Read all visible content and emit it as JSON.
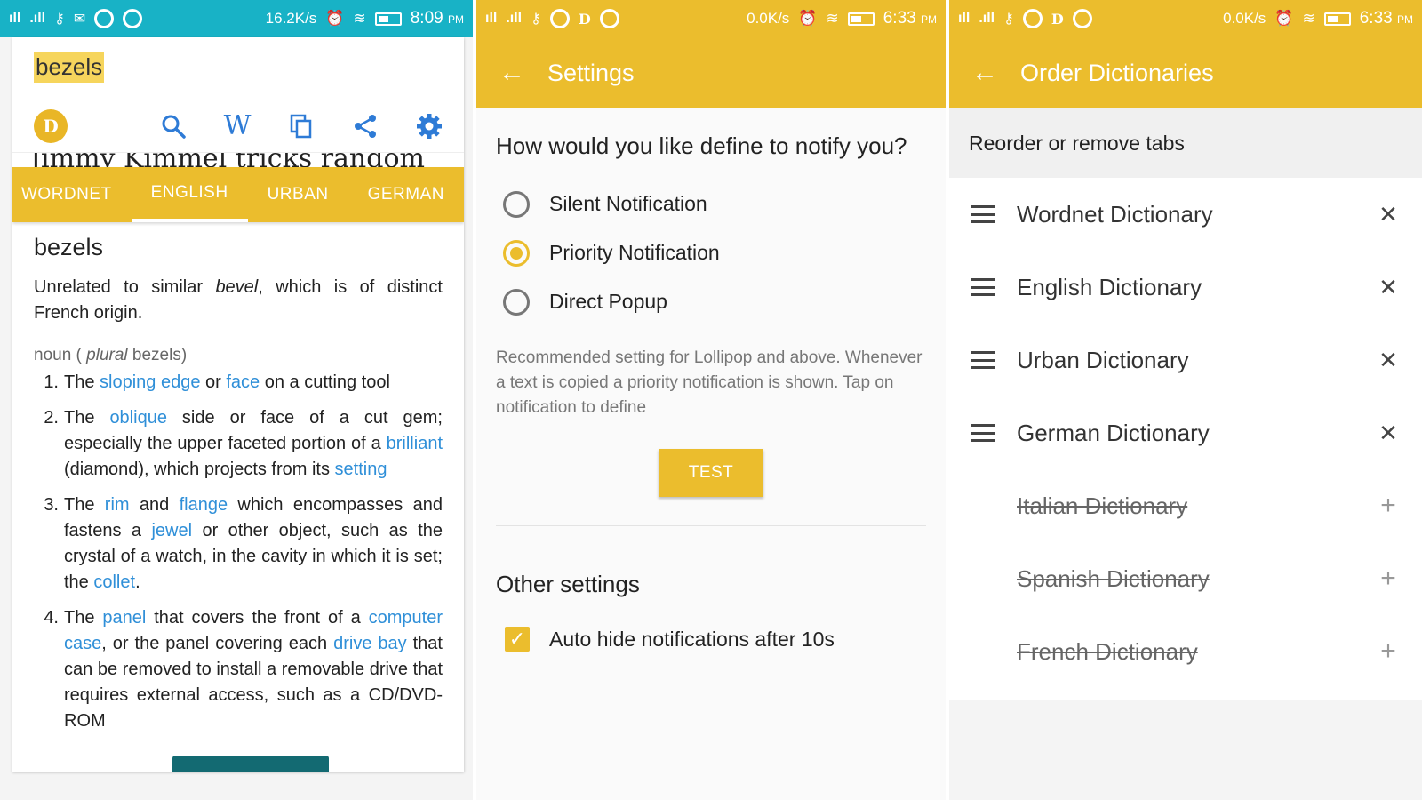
{
  "colors": {
    "teal_status": "#18b2c6",
    "accent": "#ebbd2d",
    "link": "#2f8fd8"
  },
  "panel1": {
    "status": {
      "speed": "16.2K/s",
      "time": "8:09",
      "ampm": "PM"
    },
    "search_word": "bezels",
    "toolbar": {
      "avatar_letter": "D",
      "icons": [
        "search-icon",
        "wikipedia-icon",
        "copy-icon",
        "share-icon",
        "settings-icon"
      ],
      "wiki_glyph": "W"
    },
    "peek_text": "Jimmy Kimmel tricks random",
    "tabs": [
      "WORDNET",
      "ENGLISH",
      "URBAN",
      "GERMAN"
    ],
    "active_tab": "ENGLISH",
    "definition": {
      "title": "bezels",
      "intro_a": "Unrelated to similar ",
      "intro_em": "bevel",
      "intro_b": ", which is of distinct French origin.",
      "pos_a": "noun ( ",
      "pos_em": "plural",
      "pos_b": " bezels)",
      "items": [
        {
          "num": "1.",
          "parts": [
            [
              "The ",
              false
            ],
            [
              "sloping edge",
              true
            ],
            [
              " or ",
              false
            ],
            [
              "face",
              true
            ],
            [
              " on a cutting tool",
              false
            ]
          ]
        },
        {
          "num": "2.",
          "parts": [
            [
              "The ",
              false
            ],
            [
              "oblique",
              true
            ],
            [
              " side or face of a cut gem; especially the upper faceted portion of a ",
              false
            ],
            [
              "brilliant",
              true
            ],
            [
              " (diamond), which projects from its ",
              false
            ],
            [
              "setting",
              true
            ]
          ]
        },
        {
          "num": "3.",
          "parts": [
            [
              "The ",
              false
            ],
            [
              "rim",
              true
            ],
            [
              " and ",
              false
            ],
            [
              "flange",
              true
            ],
            [
              " which encompasses and fastens a ",
              false
            ],
            [
              "jewel",
              true
            ],
            [
              " or other object, such as the crystal of a watch, in the cavity in which it is set; the ",
              false
            ],
            [
              "collet",
              true
            ],
            [
              ".",
              false
            ]
          ]
        },
        {
          "num": "4.",
          "parts": [
            [
              "The ",
              false
            ],
            [
              "panel",
              true
            ],
            [
              " that covers the front of a ",
              false
            ],
            [
              "computer case",
              true
            ],
            [
              ", or the panel covering each ",
              false
            ],
            [
              "drive bay",
              true
            ],
            [
              " that can be removed to install a removable drive that requires external access, such as a CD/DVD-ROM",
              false
            ]
          ]
        }
      ]
    }
  },
  "panel2": {
    "status": {
      "speed": "0.0K/s",
      "time": "6:33",
      "ampm": "PM",
      "d_glyph": "D"
    },
    "title": "Settings",
    "question": "How would you like define to notify you?",
    "options": [
      "Silent Notification",
      "Priority Notification",
      "Direct Popup"
    ],
    "selected": 1,
    "note": "Recommended setting for Lollipop and above. Whenever a text is copied a priority notification is shown. Tap on notification to define",
    "test_label": "TEST",
    "other_title": "Other settings",
    "auto_hide_label": "Auto hide notifications after 10s",
    "auto_hide_checked": true
  },
  "panel3": {
    "status": {
      "speed": "0.0K/s",
      "time": "6:33",
      "ampm": "PM",
      "d_glyph": "D"
    },
    "title": "Order Dictionaries",
    "header": "Reorder or remove tabs",
    "active": [
      "Wordnet Dictionary",
      "English Dictionary",
      "Urban Dictionary",
      "German Dictionary"
    ],
    "removed": [
      "Italian Dictionary",
      "Spanish Dictionary",
      "French Dictionary"
    ],
    "remove_glyph": "✕",
    "add_glyph": "+"
  }
}
